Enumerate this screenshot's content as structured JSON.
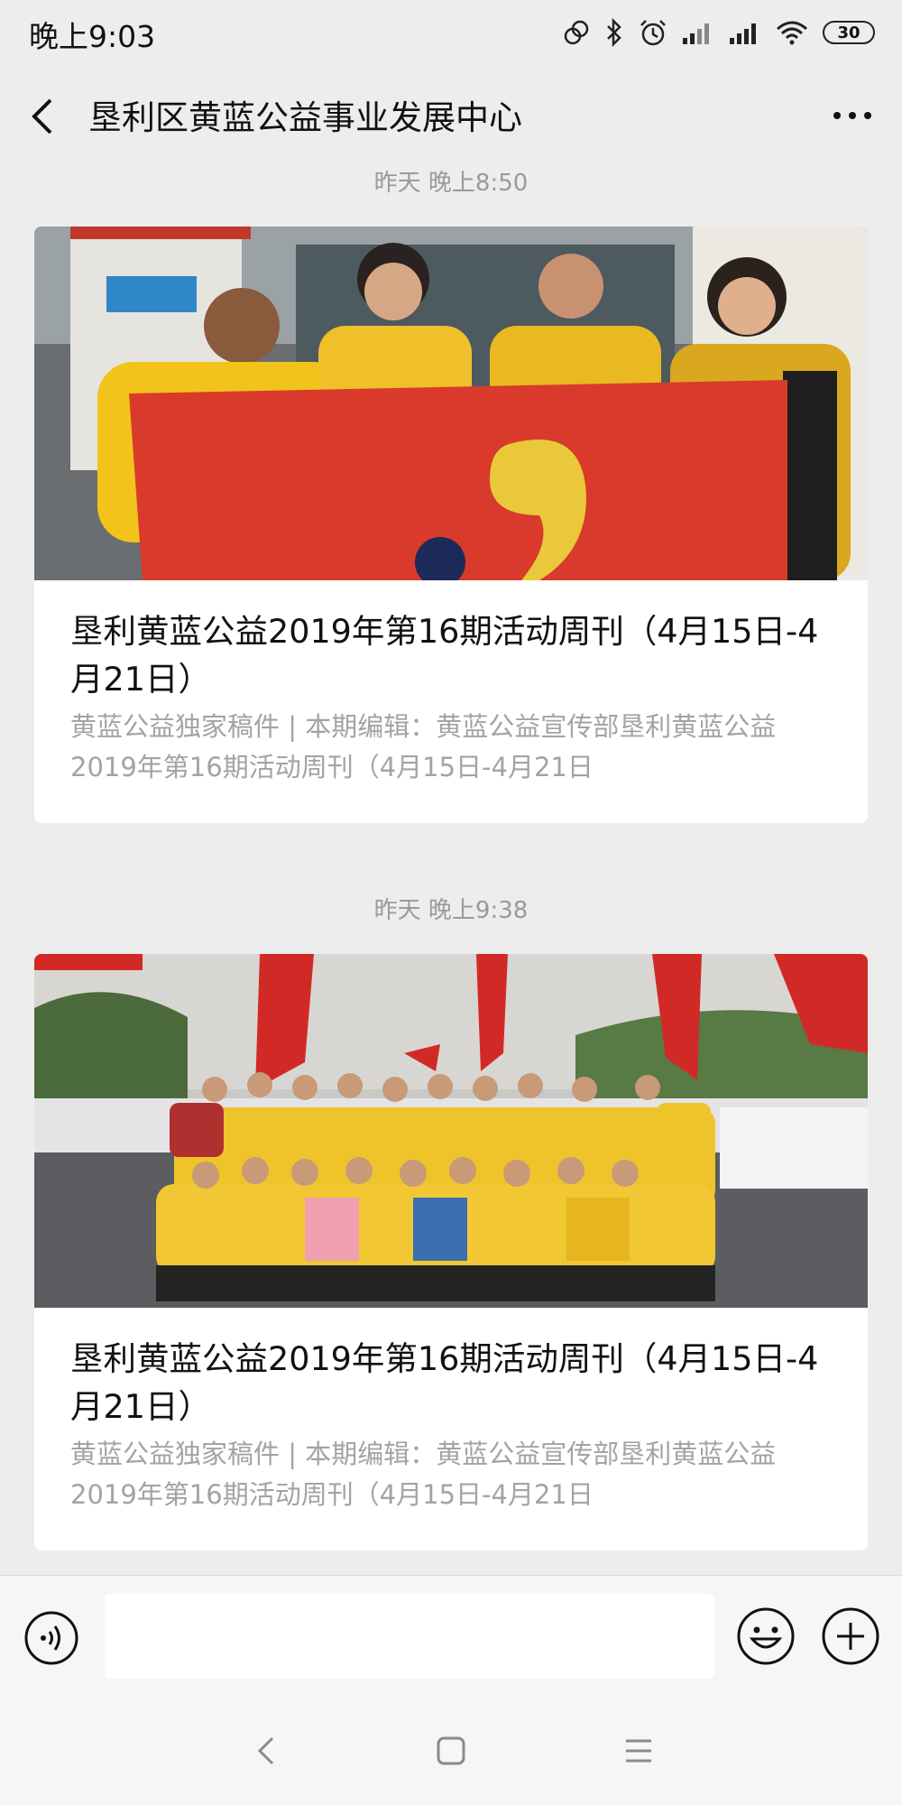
{
  "status_bar": {
    "time": "晚上9:03",
    "battery": "30",
    "icons": [
      "nfc-icon",
      "bluetooth-icon",
      "alarm-icon",
      "signal-icon",
      "signal-icon",
      "wifi-icon",
      "battery-icon"
    ]
  },
  "nav": {
    "title": "垦利区黄蓝公益事业发展中心",
    "back_icon": "back-arrow-icon",
    "more_icon": "more-dots-icon"
  },
  "messages": [
    {
      "time": "昨天 晚上8:50",
      "title": "垦利黄蓝公益2019年第16期活动周刊（4月15日-4月21日）",
      "desc": "黄蓝公益独家稿件 | 本期编辑：黄蓝公益宣传部垦利黄蓝公益2019年第16期活动周刊（4月15日-4月21日"
    },
    {
      "time": "昨天 晚上9:38",
      "title": "垦利黄蓝公益2019年第16期活动周刊（4月15日-4月21日）",
      "desc": "黄蓝公益独家稿件 | 本期编辑：黄蓝公益宣传部垦利黄蓝公益2019年第16期活动周刊（4月15日-4月21日"
    }
  ],
  "input_bar": {
    "placeholder": "",
    "voice_icon": "voice-icon",
    "emoji_icon": "emoji-icon",
    "plus_icon": "plus-icon"
  },
  "system_nav": [
    "back-icon",
    "home-icon",
    "menu-icon"
  ],
  "colors": {
    "background": "#ededed",
    "card": "#ffffff",
    "muted_text": "#9a9a9a",
    "volunteer_yellow": "#f2c31b",
    "banner_red": "#d93a2b"
  }
}
